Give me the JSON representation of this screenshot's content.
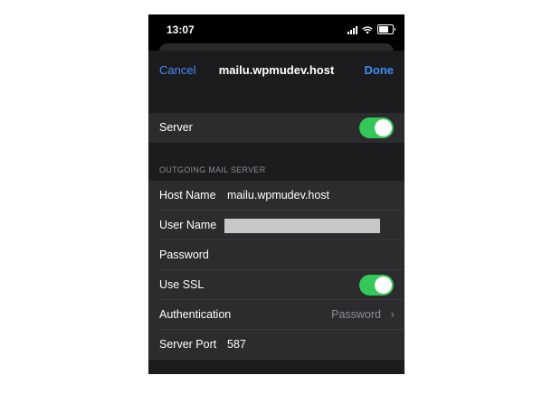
{
  "status_bar": {
    "time": "13:07"
  },
  "nav": {
    "cancel": "Cancel",
    "title": "mailu.wpmudev.host",
    "done": "Done"
  },
  "server_row": {
    "label": "Server",
    "enabled": true
  },
  "section": {
    "title": "OUTGOING MAIL SERVER"
  },
  "fields": {
    "host_name": {
      "label": "Host Name",
      "value": "mailu.wpmudev.host"
    },
    "user_name": {
      "label": "User Name",
      "value": ""
    },
    "password": {
      "label": "Password",
      "value": ""
    },
    "use_ssl": {
      "label": "Use SSL",
      "enabled": true
    },
    "authentication": {
      "label": "Authentication",
      "value": "Password"
    },
    "server_port": {
      "label": "Server Port",
      "value": "587"
    }
  },
  "colors": {
    "accent": "#3f8ef7",
    "toggle_on": "#34c759",
    "background": "#1c1c1e",
    "cell": "#2c2c2e"
  }
}
